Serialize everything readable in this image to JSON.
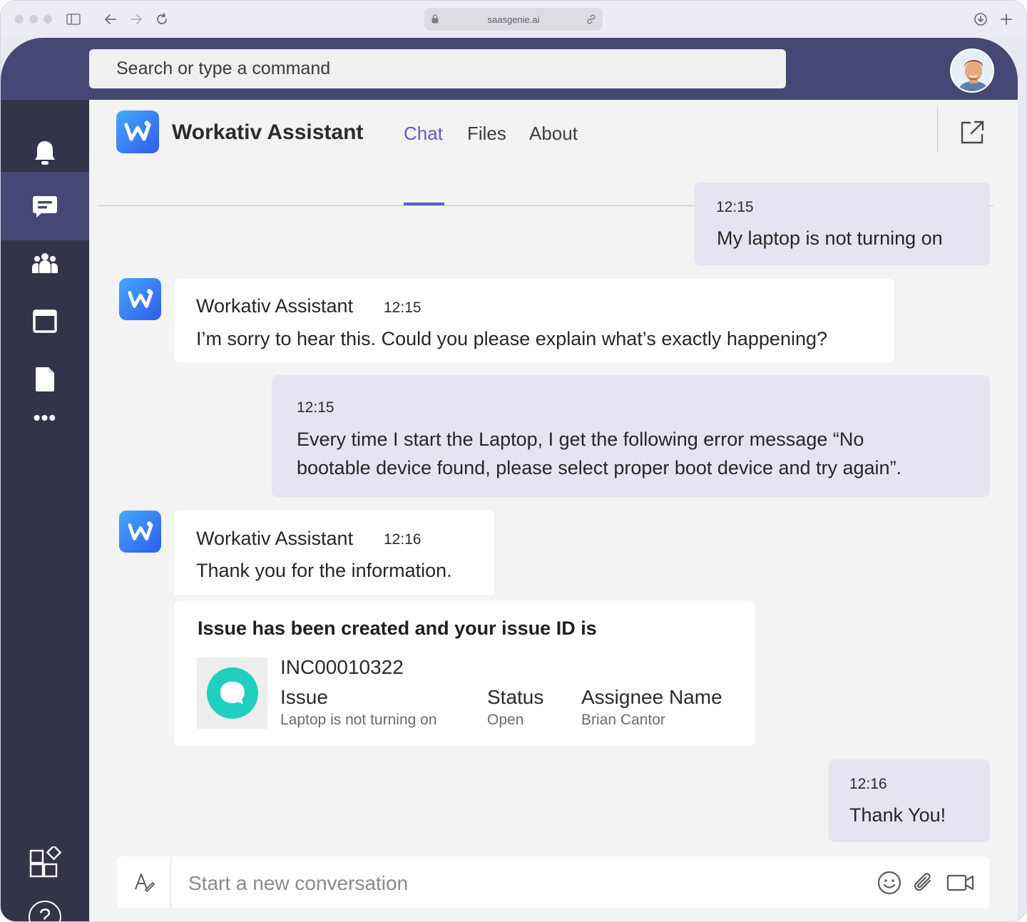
{
  "browser": {
    "url": "saasgenie.ai"
  },
  "topbar": {
    "search_placeholder": "Search or type a command"
  },
  "header": {
    "title": "Workativ Assistant",
    "tabs": [
      {
        "label": "Chat",
        "active": true
      },
      {
        "label": "Files",
        "active": false
      },
      {
        "label": "About",
        "active": false
      }
    ]
  },
  "rail": {
    "items": [
      "bell-icon",
      "chat-icon",
      "teams-icon",
      "calendar-icon",
      "files-icon",
      "more-icon",
      "apps-icon",
      "help-icon"
    ],
    "active": "chat-icon",
    "more_label": "•••",
    "help_label": "?"
  },
  "messages": [
    {
      "direction": "out",
      "time": "12:15",
      "text": "My laptop is not turning on"
    },
    {
      "direction": "in",
      "sender": "Workativ Assistant",
      "time": "12:15",
      "text": "I’m sorry to hear this. Could you please explain what’s exactly happening?"
    },
    {
      "direction": "out",
      "time": "12:15",
      "text_line1": "Every time I start the Laptop, I get the following error message “No",
      "text_line2": "bootable device found, please select proper boot device and try again”."
    },
    {
      "direction": "in",
      "sender": "Workativ Assistant",
      "time": "12:16",
      "text": "Thank you for the information."
    },
    {
      "direction": "out",
      "time": "12:16",
      "text": "Thank You!"
    }
  ],
  "issue_card": {
    "title": "Issue has been created and your issue ID is",
    "id": "INC00010322",
    "fields": [
      {
        "label": "Issue",
        "value": "Laptop is not turning on"
      },
      {
        "label": "Status",
        "value": "Open"
      },
      {
        "label": "Assignee Name",
        "value": "Brian Cantor"
      }
    ]
  },
  "compose": {
    "placeholder": "Start a new conversation"
  },
  "colors": {
    "brand": "#464775",
    "rail": "#33344a",
    "accent": "#5b5fc7",
    "outgoing_bubble": "#e5e5f1",
    "teal": "#1fcfc0"
  }
}
